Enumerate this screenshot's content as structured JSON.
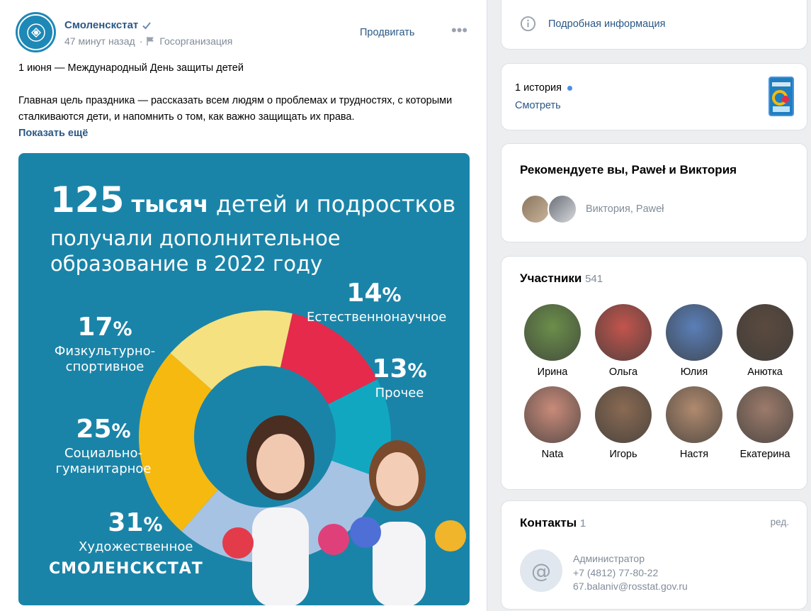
{
  "post": {
    "author": "Смоленскстат",
    "time": "47 минут назад",
    "separator": "·",
    "org_type": "Госорганизация",
    "promote": "Продвигать",
    "more": "•••",
    "text_line1": "1 июня — Международный День защиты детей",
    "text_line2": "Главная цель праздника — рассказать всем людям о проблемах и трудностях, с которыми сталкиваются дети, и напомнить о том, как важно защищать их права.",
    "show_more": "Показать ещё",
    "logo_text": "СМОЛЕНСКСТАТ"
  },
  "infographic": {
    "title_big": "125",
    "title_bold": "тысяч",
    "title_rest": "детей и подростков",
    "title_line2": "получали дополнительное",
    "title_line3": "образование в 2022 году",
    "brand": "СМОЛЕНСКСТАТ",
    "percent_sign": "%"
  },
  "chart_data": {
    "type": "pie",
    "title": "125 тысяч детей и подростков получали дополнительное образование в 2022 году",
    "categories": [
      "Естественнонаучное",
      "Прочее",
      "Художественное",
      "Социально-гуманитарное",
      "Физкультурно-спортивное"
    ],
    "values": [
      14,
      13,
      31,
      25,
      17
    ],
    "unit": "%",
    "colors": [
      "#e52a4b",
      "#12a7c1",
      "#a6c3e3",
      "#f6b90f",
      "#f5e17f"
    ],
    "labels": [
      {
        "pct": "14",
        "cat": "Естественнонаучное"
      },
      {
        "pct": "13",
        "cat": "Прочее"
      },
      {
        "pct": "31",
        "cat": "Художественное"
      },
      {
        "pct": "25",
        "cat": "Социально-гуманитарное",
        "cat1": "Социально-",
        "cat2": "гуманитарное"
      },
      {
        "pct": "17",
        "cat": "Физкультурно-спортивное",
        "cat1": "Физкультурно-",
        "cat2": "спортивное"
      }
    ]
  },
  "sidebar": {
    "info_link": "Подробная информация",
    "story_count": "1 история",
    "story_link": "Смотреть",
    "rec_title": "Рекомендуете вы, Paweł и Виктория",
    "rec_names": "Виктория, Paweł",
    "members_title": "Участники",
    "members_count": "541",
    "members": [
      {
        "name": "Ирина",
        "color": "#6b8f4a"
      },
      {
        "name": "Ольга",
        "color": "#c2554d"
      },
      {
        "name": "Юлия",
        "color": "#5a7fb8"
      },
      {
        "name": "Анютка",
        "color": "#5b4a3e"
      },
      {
        "name": "Nata",
        "color": "#c98b7a"
      },
      {
        "name": "Игорь",
        "color": "#8a6a52"
      },
      {
        "name": "Настя",
        "color": "#b08a6e"
      },
      {
        "name": "Екатерина",
        "color": "#9c7b6a"
      }
    ],
    "contacts_title": "Контакты",
    "contacts_count": "1",
    "edit": "ред.",
    "contact_avatar": "@",
    "contact_role": "Администратор",
    "contact_phone": "+7 (4812) 77-80-22",
    "contact_email": "67.balaniv@rosstat.gov.ru"
  }
}
